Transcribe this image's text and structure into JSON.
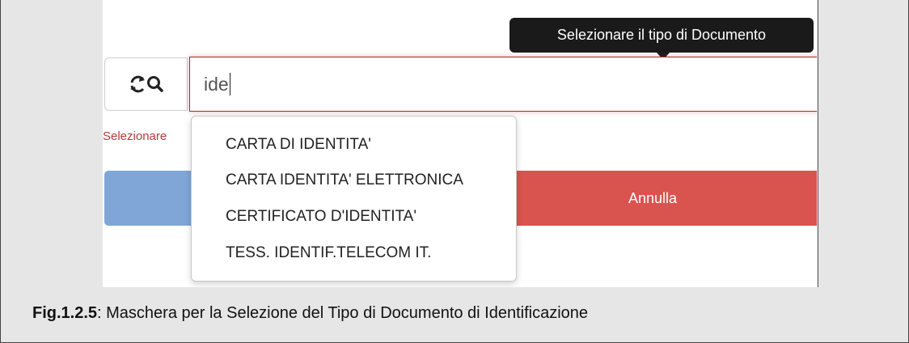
{
  "tooltip": {
    "text": "Selezionare il tipo di Documento"
  },
  "search": {
    "icon": "refresh-search-icon",
    "value": "ide",
    "focus_color": "#b22a2a"
  },
  "error": {
    "text": "Selezionare"
  },
  "buttons": {
    "primary_label": "",
    "cancel_label": "Annulla",
    "primary_color": "#7fa6d6",
    "cancel_color": "#d9534f"
  },
  "dropdown": {
    "options": [
      "CARTA DI IDENTITA'",
      "CARTA IDENTITA' ELETTRONICA",
      "CERTIFICATO D'IDENTITA'",
      "TESS. IDENTIF.TELECOM IT."
    ]
  },
  "caption": {
    "label": "Fig.1.2.5",
    "text": ": Maschera per la Selezione del Tipo di Documento di Identificazione"
  }
}
